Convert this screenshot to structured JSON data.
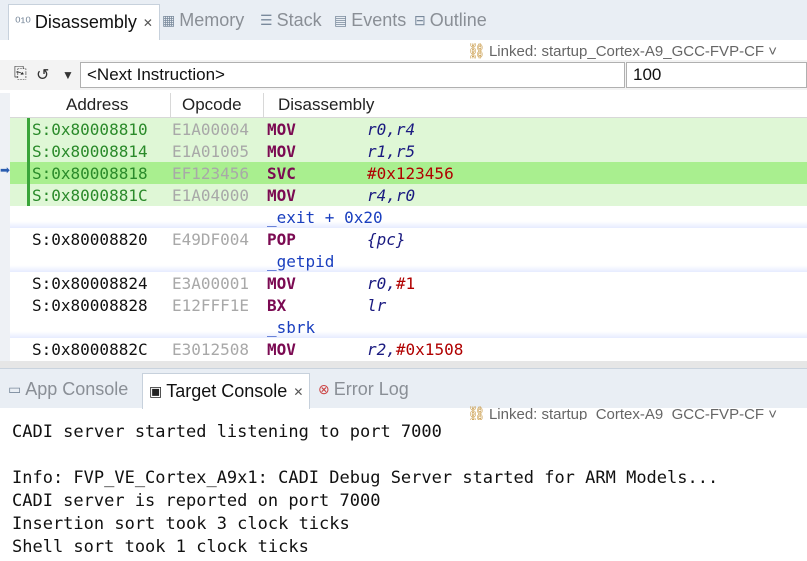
{
  "top_tabs": {
    "disassembly": "Disassembly",
    "memory": "Memory",
    "stack": "Stack",
    "events": "Events",
    "outline": "Outline"
  },
  "linked_label": "Linked: startup_Cortex-A9_GCC-FVP-CF",
  "toolbar": {
    "address_value": "<Next Instruction>",
    "count_value": "100"
  },
  "columns": {
    "address": "Address",
    "opcode": "Opcode",
    "disassembly": "Disassembly"
  },
  "rows": [
    {
      "type": "instr",
      "addr": "S:0x80008810",
      "op": "E1A00004",
      "mn": "MOV",
      "args": "r0,r4",
      "hl": true
    },
    {
      "type": "instr",
      "addr": "S:0x80008814",
      "op": "E1A01005",
      "mn": "MOV",
      "args": "r1,r5",
      "hl": true
    },
    {
      "type": "instr",
      "addr": "S:0x80008818",
      "op": "EF123456",
      "mn": "SVC",
      "args": "#0x123456",
      "hl": true,
      "pc": true
    },
    {
      "type": "instr",
      "addr": "S:0x8000881C",
      "op": "E1A04000",
      "mn": "MOV",
      "args": "r4,r0",
      "hl": true
    },
    {
      "type": "label",
      "text": "_exit + 0x20"
    },
    {
      "type": "instr",
      "addr": "S:0x80008820",
      "op": "E49DF004",
      "mn": "POP",
      "args": "{pc}"
    },
    {
      "type": "label",
      "text": "_getpid"
    },
    {
      "type": "instr",
      "addr": "S:0x80008824",
      "op": "E3A00001",
      "mn": "MOV",
      "args": "r0,#1"
    },
    {
      "type": "instr",
      "addr": "S:0x80008828",
      "op": "E12FFF1E",
      "mn": "BX",
      "args": "lr"
    },
    {
      "type": "label",
      "text": "_sbrk"
    },
    {
      "type": "instr",
      "addr": "S:0x8000882C",
      "op": "E3012508",
      "mn": "MOV",
      "args": "r2,#0x1508"
    }
  ],
  "bottom_tabs": {
    "app_console": "App Console",
    "target_console": "Target Console",
    "error_log": "Error Log"
  },
  "console_lines": [
    "CADI server started listening to port 7000",
    "",
    "Info: FVP_VE_Cortex_A9x1: CADI Debug Server started for ARM Models...",
    "CADI server is reported on port 7000",
    "Insertion sort took 3 clock ticks",
    "Shell sort took 1 clock ticks"
  ]
}
